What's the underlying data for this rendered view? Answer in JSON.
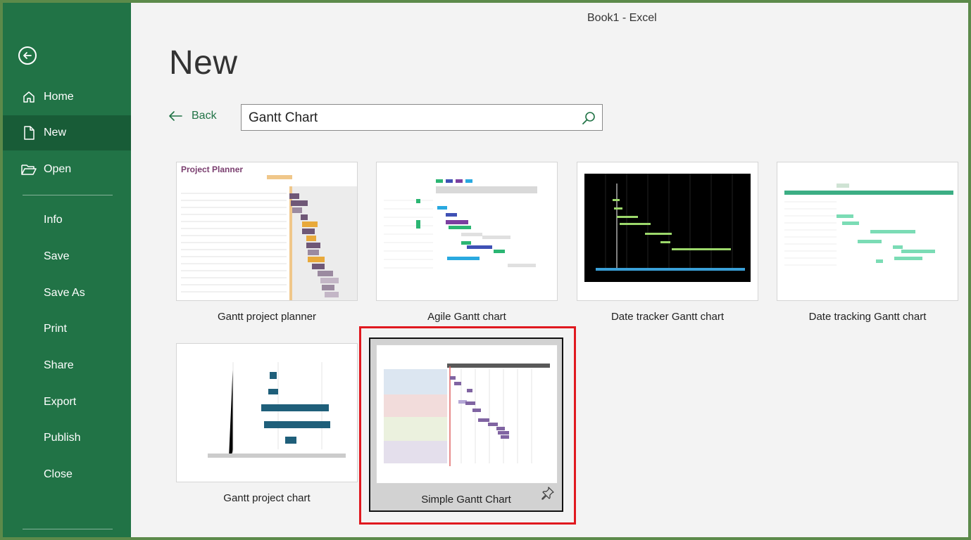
{
  "window": {
    "title": "Book1  -  Excel"
  },
  "sidebar": {
    "back_icon": "back-arrow-circle-icon",
    "items": [
      {
        "label": "Home",
        "icon": "home-icon"
      },
      {
        "label": "New",
        "icon": "new-document-icon",
        "active": true
      },
      {
        "label": "Open",
        "icon": "folder-open-icon"
      },
      {
        "label": "Info"
      },
      {
        "label": "Save"
      },
      {
        "label": "Save As"
      },
      {
        "label": "Print"
      },
      {
        "label": "Share"
      },
      {
        "label": "Export"
      },
      {
        "label": "Publish"
      },
      {
        "label": "Close"
      }
    ]
  },
  "main": {
    "title": "New",
    "back_label": "Back",
    "search": {
      "value": "Gantt Chart",
      "icon": "search-icon"
    }
  },
  "templates": [
    {
      "name": "Gantt project planner",
      "thumb_title": "Project Planner"
    },
    {
      "name": "Agile Gantt chart"
    },
    {
      "name": "Date tracker Gantt chart"
    },
    {
      "name": "Date tracking Gantt chart"
    },
    {
      "name": "Gantt project chart"
    },
    {
      "name": "Simple Gantt Chart",
      "selected": true,
      "pin_icon": "pin-icon"
    }
  ],
  "colors": {
    "accent": "#217346",
    "sidebar_active": "#185c37",
    "highlight_box": "#e0191f"
  }
}
